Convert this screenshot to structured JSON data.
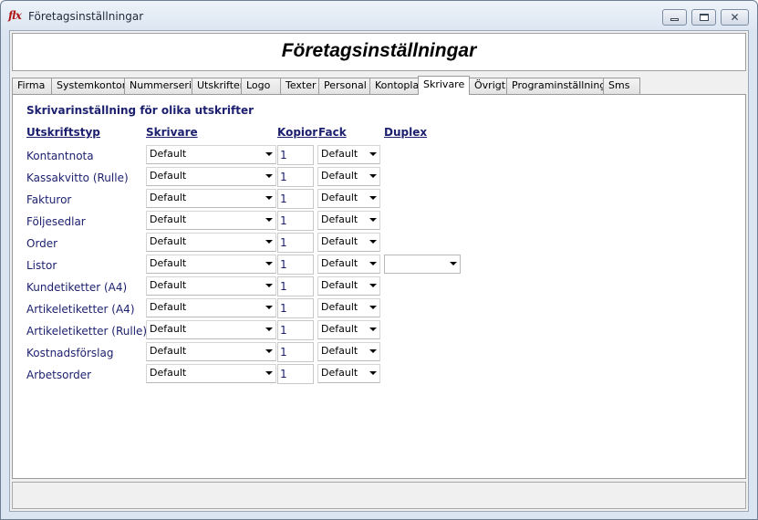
{
  "window": {
    "icon_text": "flx",
    "title": "Företagsinställningar"
  },
  "header": {
    "title": "Företagsinställningar"
  },
  "tabs": [
    {
      "label": "Firma"
    },
    {
      "label": "Systemkonton"
    },
    {
      "label": "Nummerserier"
    },
    {
      "label": "Utskrifter"
    },
    {
      "label": "Logo"
    },
    {
      "label": "Texter"
    },
    {
      "label": "Personal"
    },
    {
      "label": "Kontoplan"
    },
    {
      "label": "Skrivare"
    },
    {
      "label": "Övrigt"
    },
    {
      "label": "Programinställningar"
    },
    {
      "label": "Sms"
    }
  ],
  "active_tab": "Skrivare",
  "panel": {
    "section_title": "Skrivarinställning för olika utskrifter",
    "columns": {
      "type": "Utskriftstyp",
      "printer": "Skrivare",
      "copies": "Kopior",
      "tray": "Fack",
      "duplex": "Duplex"
    },
    "rows": [
      {
        "label": "Kontantnota",
        "printer": "Default",
        "copies": "1",
        "tray": "Default"
      },
      {
        "label": "Kassakvitto (Rulle)",
        "printer": "Default",
        "copies": "1",
        "tray": "Default"
      },
      {
        "label": "Fakturor",
        "printer": "Default",
        "copies": "1",
        "tray": "Default"
      },
      {
        "label": "Följesedlar",
        "printer": "Default",
        "copies": "1",
        "tray": "Default"
      },
      {
        "label": "Order",
        "printer": "Default",
        "copies": "1",
        "tray": "Default"
      },
      {
        "label": "Listor",
        "printer": "Default",
        "copies": "1",
        "tray": "Default",
        "duplex": ""
      },
      {
        "label": "Kundetiketter (A4)",
        "printer": "Default",
        "copies": "1",
        "tray": "Default"
      },
      {
        "label": "Artikeletiketter (A4)",
        "printer": "Default",
        "copies": "1",
        "tray": "Default"
      },
      {
        "label": "Artikeletiketter (Rulle)",
        "printer": "Default",
        "copies": "1",
        "tray": "Default"
      },
      {
        "label": "Kostnadsförslag",
        "printer": "Default",
        "copies": "1",
        "tray": "Default"
      },
      {
        "label": "Arbetsorder",
        "printer": "Default",
        "copies": "1",
        "tray": "Default"
      }
    ]
  },
  "colors": {
    "label_text": "#1b1f6e",
    "window_frame": "#dbe5f1",
    "app_icon": "#b01818"
  }
}
